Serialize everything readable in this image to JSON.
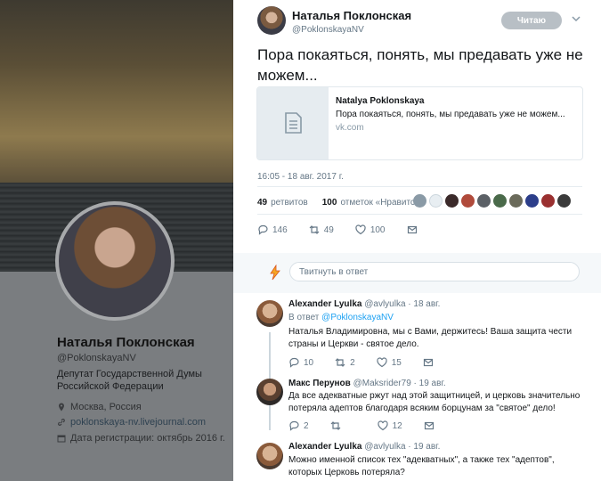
{
  "profile": {
    "name": "Наталья Поклонская",
    "handle": "@PoklonskayaNV",
    "bio": "Депутат Государственной Думы Российской Федерации",
    "location": "Москва, Россия",
    "website": "poklonskaya-nv.livejournal.com",
    "joined": "Дата регистрации: октябрь 2016 г."
  },
  "tweet": {
    "author_name": "Наталья Поклонская",
    "author_handle": "@PoklonskayaNV",
    "follow_label": "Читаю",
    "text": "Пора покаяться, понять, мы предавать уже не можем...",
    "card": {
      "title": "Natalya Poklonskaya",
      "description": "Пора покаяться, понять, мы предавать уже не можем...",
      "domain": "vk.com"
    },
    "timestamp": "16:05 - 18 авг. 2017 г.",
    "retweets_count": "49",
    "retweets_label": "ретвитов",
    "likes_count": "100",
    "likes_label": "отметок «Нравится»",
    "replies": "146",
    "retweets": "49",
    "likes": "100"
  },
  "reply_box": {
    "placeholder": "Твитнуть в ответ"
  },
  "replies": [
    {
      "name": "Alexander Lyulka",
      "handle": "@avlyulka",
      "time": "· 18 авг.",
      "in_reply_prefix": "В ответ",
      "in_reply_handle": "@PoklonskayaNV",
      "text": "Наталья Владимировна, мы с Вами, держитесь! Ваша защита чести страны и Церкви - святое дело.",
      "replies": "10",
      "retweets": "2",
      "likes": "15"
    },
    {
      "name": "Макс Перунов",
      "handle": "@Maksrider79",
      "time": "· 19 авг.",
      "text": "Да все адекватные ржут над этой защитницей, и церковь значительно потеряла адептов благодаря всяким борцунам за \"святое\" дело!",
      "replies": "2",
      "retweets": "",
      "likes": "12"
    },
    {
      "name": "Alexander Lyulka",
      "handle": "@avlyulka",
      "time": "· 19 авг.",
      "text": "Можно именной список тех \"адекватных\", а также тех \"адептов\", которых Церковь потеряла?"
    }
  ],
  "colors": {
    "link": "#1da1f2",
    "muted": "#657786",
    "follow_bg": "#b8bfc5"
  }
}
